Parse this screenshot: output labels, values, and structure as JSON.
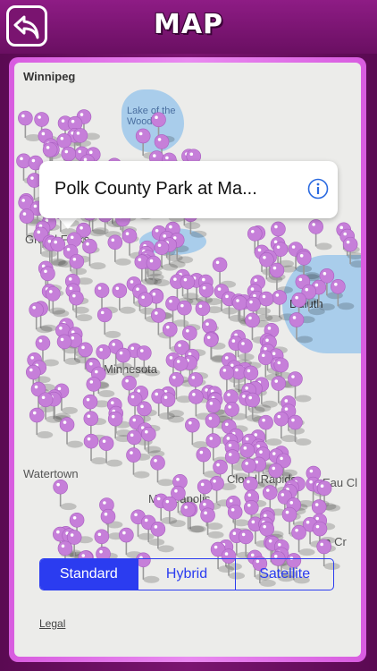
{
  "header": {
    "title": "MAP",
    "back_icon": "back-arrow-icon"
  },
  "map": {
    "places": [
      {
        "name": "Winnipeg",
        "style": "dark"
      },
      {
        "name": "Lake of the Woods",
        "style": "water"
      },
      {
        "name": "Grand Forks",
        "style": "normal"
      },
      {
        "name": "Duluth",
        "style": "dark"
      },
      {
        "name": "Minnesota",
        "style": "normal"
      },
      {
        "name": "Cloud Rapids",
        "style": "normal"
      },
      {
        "name": "Watertown",
        "style": "normal"
      },
      {
        "name": "Eau Cl",
        "style": "normal"
      },
      {
        "name": "Minneapolis",
        "style": "normal"
      },
      {
        "name": "La Cr",
        "style": "normal"
      }
    ],
    "pin_color": "#c67fd9",
    "legal_label": "Legal"
  },
  "callout": {
    "text": "Polk County Park at Ma...",
    "icon": "info-icon"
  },
  "map_type": {
    "options": [
      "Standard",
      "Hybrid",
      "Satellite"
    ],
    "selected": "Standard",
    "accent": "#2b3cf0"
  }
}
